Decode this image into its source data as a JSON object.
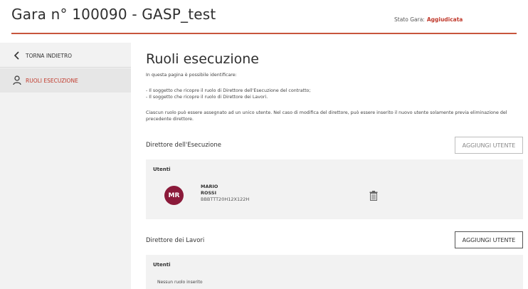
{
  "header": {
    "title": "Gara n° 100090 - GASP_test",
    "status_label": "Stato Gara:",
    "status_value": "Aggiudicata"
  },
  "sidebar": {
    "back_label": "TORNA INDIETRO",
    "active_label": "RUOLI ESECUZIONE"
  },
  "main": {
    "title": "Ruoli esecuzione",
    "intro": "In questa pagina è possibile identificare:",
    "bullet1": "- Il soggetto che ricopre il ruolo di Direttore dell'Esecuzione del contratto;",
    "bullet2": "- Il soggetto che ricopre il ruolo di Direttore dei Lavori.",
    "paragraph": "Ciascun ruolo può essere assegnato ad un unico utente. Nel caso di modifica del direttore, può essere inserito il nuovo utente solamente previa eliminazione del precedente direttore."
  },
  "sections": [
    {
      "title": "Direttore dell'Esecuzione",
      "add_button": "AGGIUNGI UTENTE",
      "users_label": "Utenti",
      "user": {
        "initials": "MR",
        "first_name": "MARIO",
        "last_name": "ROSSI",
        "fiscal_code": "BBBTTT20H12X122H"
      }
    },
    {
      "title": "Direttore dei Lavori",
      "add_button": "AGGIUNGI UTENTE",
      "users_label": "Utenti",
      "empty_message": "Nessun ruolo inserito"
    }
  ],
  "colors": {
    "accent": "#c0392b",
    "header_line": "#c8553d",
    "avatar": "#8b1a3a"
  },
  "icons": {
    "back": "chevron-left-icon",
    "user": "user-icon",
    "delete": "trash-icon"
  }
}
